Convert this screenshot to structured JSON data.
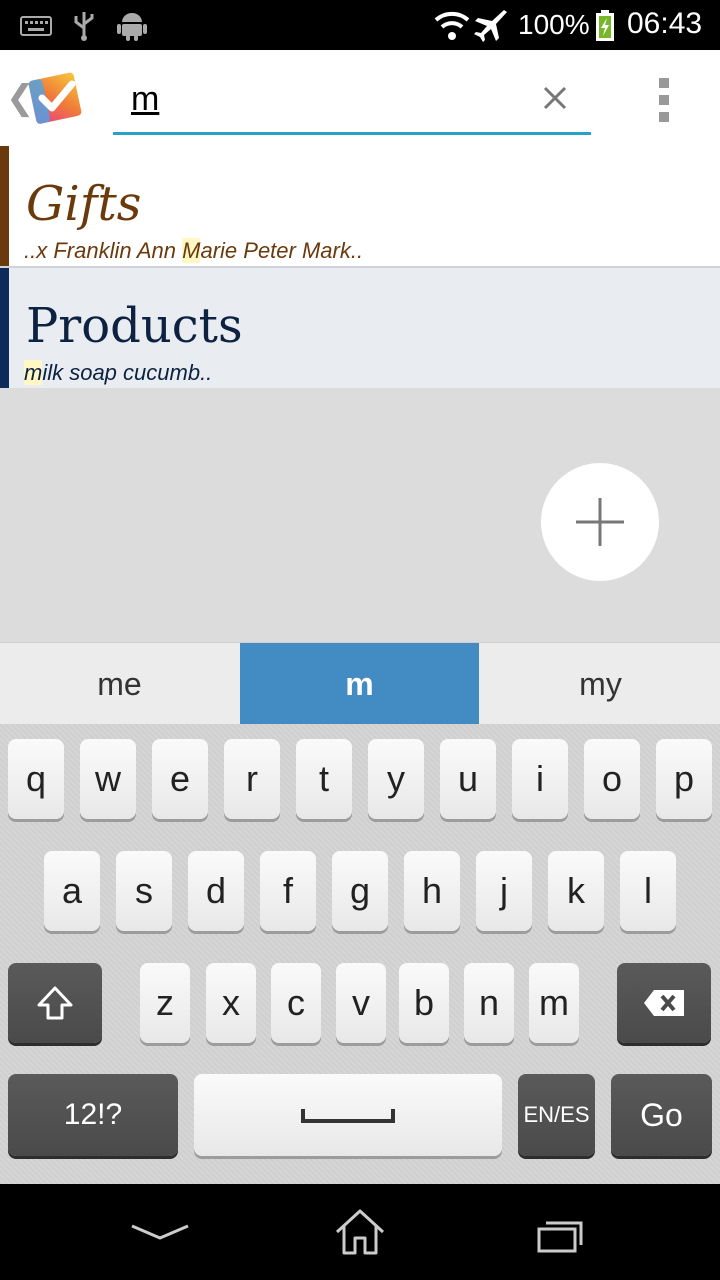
{
  "status_bar": {
    "battery_percent": "100%",
    "time": "06:43",
    "icons": [
      "keyboard-icon",
      "usb-icon",
      "android-icon",
      "wifi-icon",
      "airplane-mode-icon",
      "battery-charging-icon"
    ]
  },
  "action_bar": {
    "search_value": "m",
    "icons": [
      "back-chevron-icon",
      "app-logo-icon",
      "clear-icon",
      "overflow-menu-icon"
    ]
  },
  "lists": [
    {
      "title": "Gifts",
      "preview_before": "..x Franklin Ann ",
      "preview_match": "M",
      "preview_after": "arie Peter Mark..",
      "color": "#6b3a0c",
      "stripe_color": "#6b3a0c"
    },
    {
      "title": "Products",
      "preview_before": "",
      "preview_match": "m",
      "preview_after": "ilk soap cucumb..",
      "color": "#0c2240",
      "stripe_color": "#0c2a5a"
    }
  ],
  "fab": {
    "icon": "plus-icon"
  },
  "keyboard": {
    "suggestions": [
      "me",
      "m",
      "my"
    ],
    "active_suggestion": "m",
    "rows": [
      [
        "q",
        "w",
        "e",
        "r",
        "t",
        "y",
        "u",
        "i",
        "o",
        "p"
      ],
      [
        "a",
        "s",
        "d",
        "f",
        "g",
        "h",
        "j",
        "k",
        "l"
      ],
      [
        "z",
        "x",
        "c",
        "v",
        "b",
        "n",
        "m"
      ]
    ],
    "symbols_label": "12!?",
    "language_label": "EN/ES",
    "go_label": "Go",
    "icons": [
      "shift-icon",
      "backspace-icon",
      "space-icon"
    ]
  },
  "nav_bar": {
    "icons": [
      "hide-keyboard-icon",
      "home-icon",
      "recents-icon"
    ]
  },
  "colors": {
    "accent": "#2aa3c8",
    "suggestion_active": "#428bc3",
    "match_highlight": "#fff7c4"
  }
}
